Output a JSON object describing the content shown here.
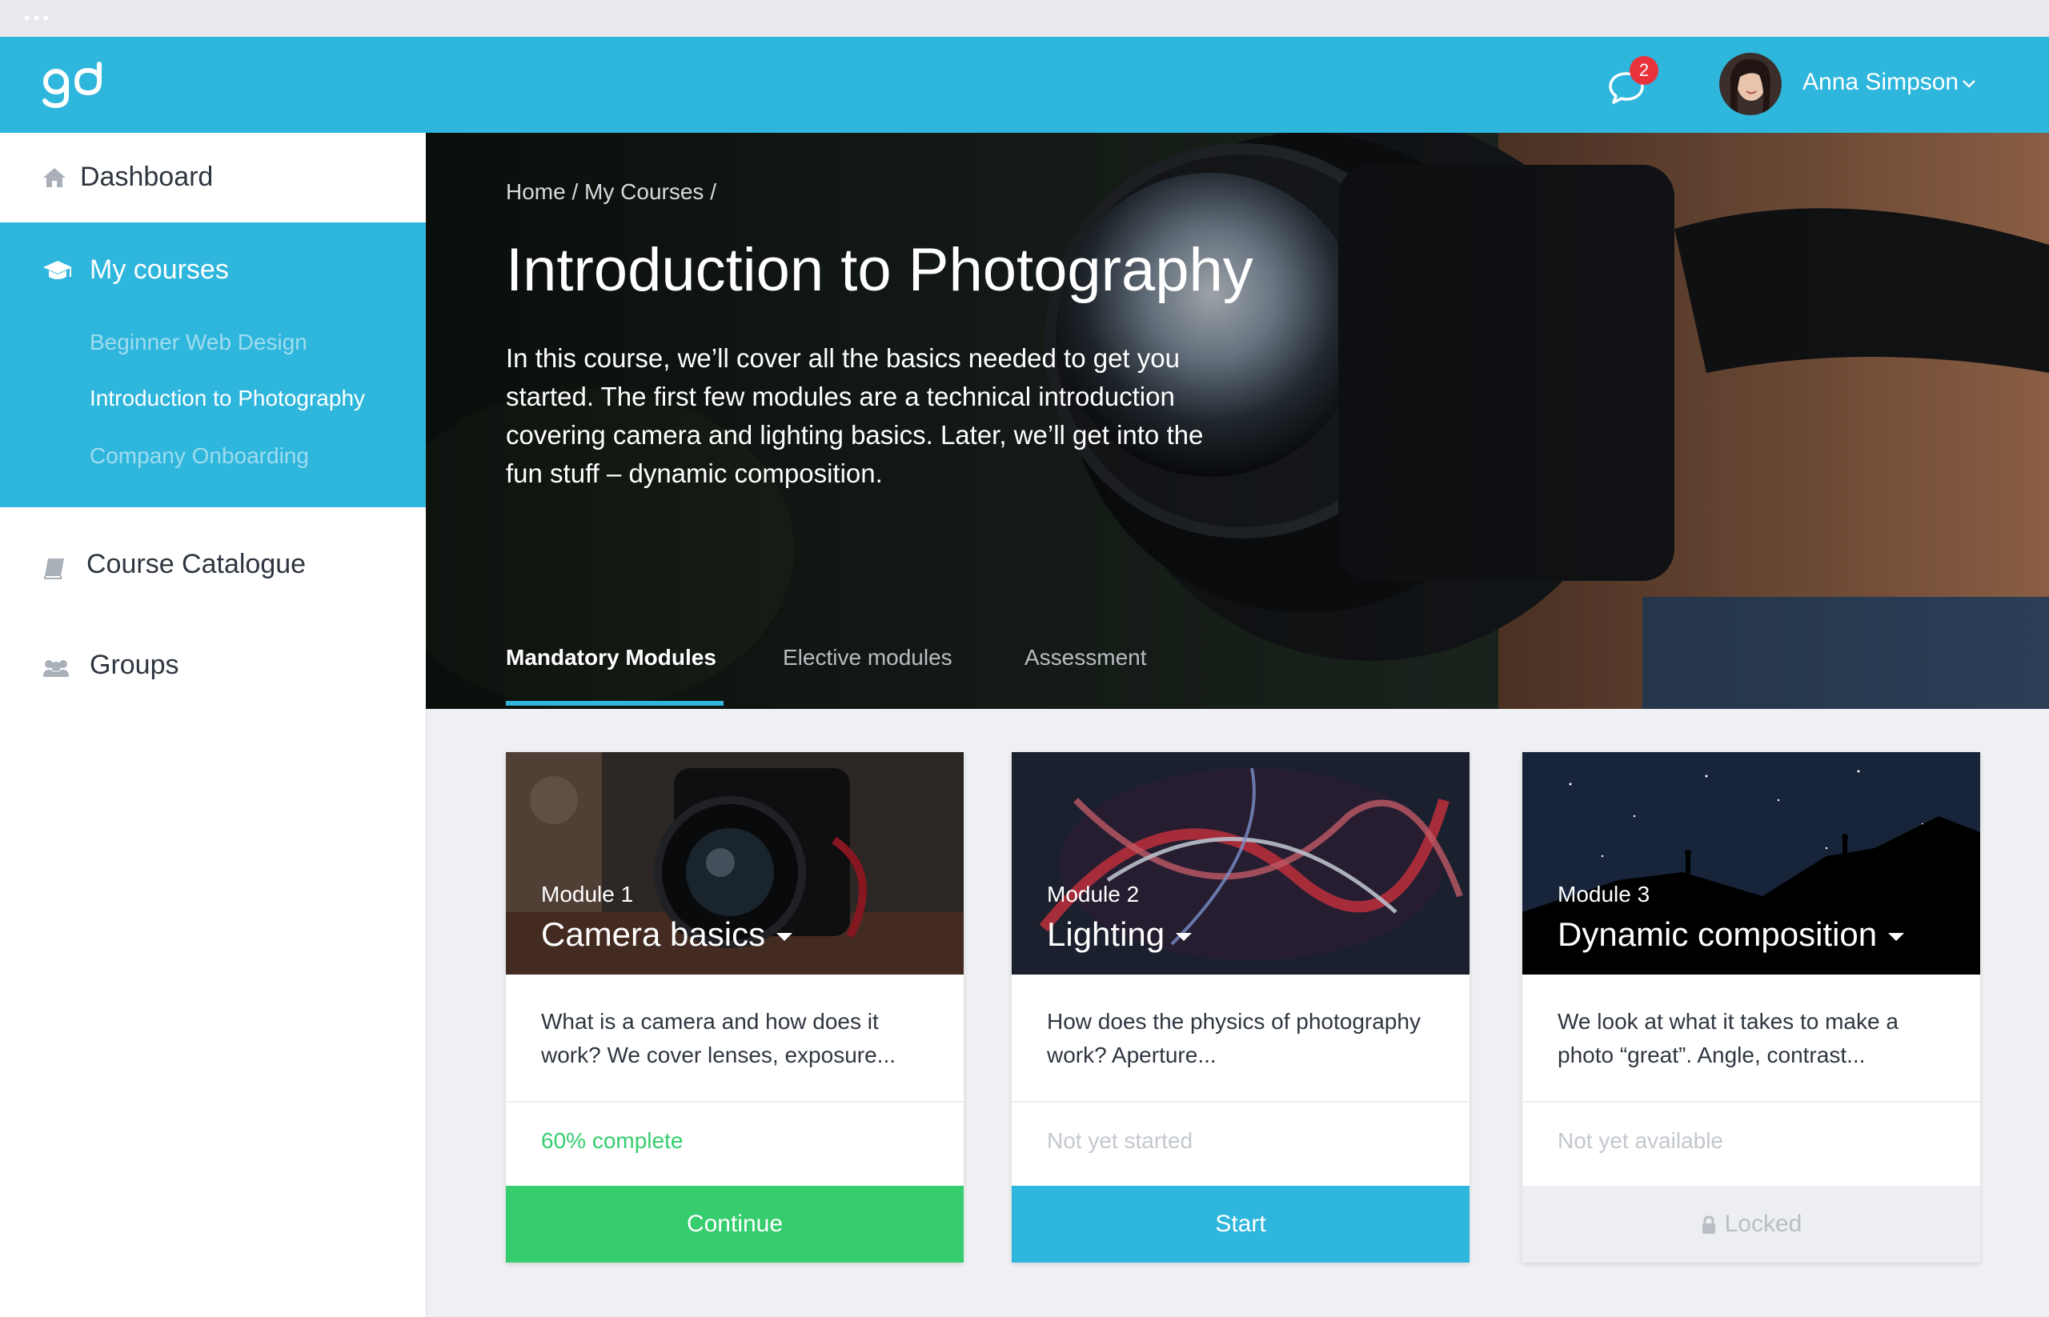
{
  "topbar": {
    "logo_text": "go",
    "notification_count": "2",
    "user_name": "Anna Simpson"
  },
  "sidebar": {
    "dashboard": "Dashboard",
    "my_courses": "My courses",
    "courses": [
      "Beginner Web Design",
      "Introduction to Photography",
      "Company Onboarding"
    ],
    "catalogue": "Course Catalogue",
    "groups": "Groups"
  },
  "hero": {
    "breadcrumb": [
      "Home",
      "My Courses"
    ],
    "title": "Introduction to Photography",
    "description": "In this course, we’ll cover all the basics needed to get you started. The first few modules are a technical introduction covering camera and lighting basics. Later, we’ll get into the fun stuff – dynamic composition.",
    "tabs": [
      "Mandatory Modules",
      "Elective modules",
      "Assessment"
    ]
  },
  "modules": [
    {
      "number": "Module 1",
      "title": "Camera basics",
      "description": "What is a camera and how does it work? We cover lenses, exposure...",
      "status": "60% complete",
      "progress": 0.6,
      "action": "Continue"
    },
    {
      "number": "Module 2",
      "title": "Lighting",
      "description": "How does the physics of photography work? Aperture...",
      "status": "Not yet started",
      "action": "Start"
    },
    {
      "number": "Module 3",
      "title": "Dynamic composition",
      "description": "We look at what it takes to make a photo “great”. Angle, contrast...",
      "status": "Not yet available",
      "action": "Locked"
    }
  ],
  "colors": {
    "brand": "#2fb6dc",
    "success": "#36cd6e",
    "badge": "#e8333d",
    "muted": "#c3c8ce"
  }
}
